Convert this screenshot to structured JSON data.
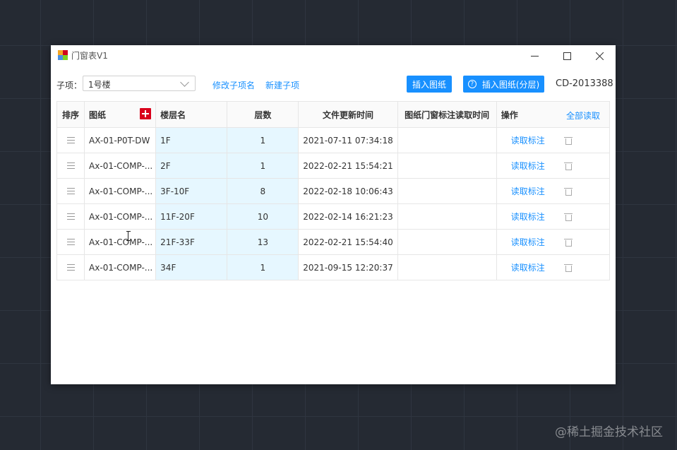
{
  "window": {
    "title": "门窗表V1",
    "minimize_icon": "minimize-icon",
    "maximize_icon": "maximize-icon",
    "close_icon": "close-icon"
  },
  "toolbar": {
    "subitem_label": "子项：",
    "subitem_value": "1号楼",
    "rename_link": "修改子项名",
    "new_link": "新建子项",
    "insert_drawing_btn": "插入图纸",
    "insert_layered_btn": "插入图纸(分层)",
    "code": "CD-2013388"
  },
  "table": {
    "headers": {
      "sort": "排序",
      "drawing": "图纸",
      "floor_name": "楼层名",
      "floor_count": "层数",
      "file_time": "文件更新时间",
      "read_time": "图纸门窗标注读取时间",
      "actions": "操作",
      "read_all": "全部读取"
    },
    "rows": [
      {
        "drawing": "AX-01-P0T-DW",
        "floor": "1F",
        "count": "1",
        "time": "2021-07-11 07:34:18",
        "read_time": "",
        "action": "读取标注"
      },
      {
        "drawing": "Ax-01-COMP-...",
        "floor": "2F",
        "count": "1",
        "time": "2022-02-21 15:54:21",
        "read_time": "",
        "action": "读取标注"
      },
      {
        "drawing": "Ax-01-COMP-...",
        "floor": "3F-10F",
        "count": "8",
        "time": "2022-02-18 10:06:43",
        "read_time": "",
        "action": "读取标注"
      },
      {
        "drawing": "Ax-01-COMP-...",
        "floor": "11F-20F",
        "count": "10",
        "time": "2022-02-14 16:21:23",
        "read_time": "",
        "action": "读取标注"
      },
      {
        "drawing": "Ax-01-COMP-...",
        "floor": "21F-33F",
        "count": "13",
        "time": "2022-02-21 15:54:40",
        "read_time": "",
        "action": "读取标注"
      },
      {
        "drawing": "Ax-01-COMP-...",
        "floor": "34F",
        "count": "1",
        "time": "2021-09-15 12:20:37",
        "read_time": "",
        "action": "读取标注"
      }
    ]
  },
  "watermark": "@稀土掘金技术社区",
  "colors": {
    "accent": "#1890ff",
    "danger": "#d9001b",
    "highlight": "#e6f7ff",
    "desktop": "#252a33"
  }
}
